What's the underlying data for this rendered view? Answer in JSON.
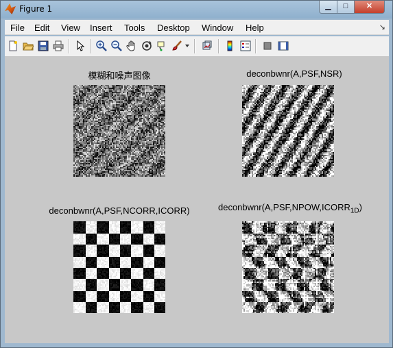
{
  "window": {
    "title": "Figure 1"
  },
  "menu": [
    "File",
    "Edit",
    "View",
    "Insert",
    "Tools",
    "Desktop",
    "Window",
    "Help"
  ],
  "toolbar": {
    "icons": [
      "new-file-icon",
      "open-folder-icon",
      "save-icon",
      "print-icon",
      "pointer-icon",
      "zoom-in-icon",
      "zoom-out-icon",
      "pan-hand-icon",
      "rotate-3d-icon",
      "data-cursor-icon",
      "brush-icon",
      "dropdown-arrow-icon",
      "link-plot-icon",
      "colorbar-icon",
      "legend-icon",
      "hide-plot-tools-icon",
      "show-plot-tools-icon"
    ]
  },
  "subplots": {
    "tl": {
      "title": "模糊和噪声图像"
    },
    "tr": {
      "title": "deconbwnr(A,PSF,NSR)"
    },
    "bl": {
      "title": "deconbwnr(A,PSF,NCORR,ICORR)"
    },
    "br": {
      "title": "deconbwnr(A,PSF,NPOW,ICORR",
      "subscript": "1D",
      "suffix": ")"
    }
  },
  "colors": {
    "figure_bg": "#c8c8c8",
    "menubar_bg": "#f0f0f0"
  }
}
